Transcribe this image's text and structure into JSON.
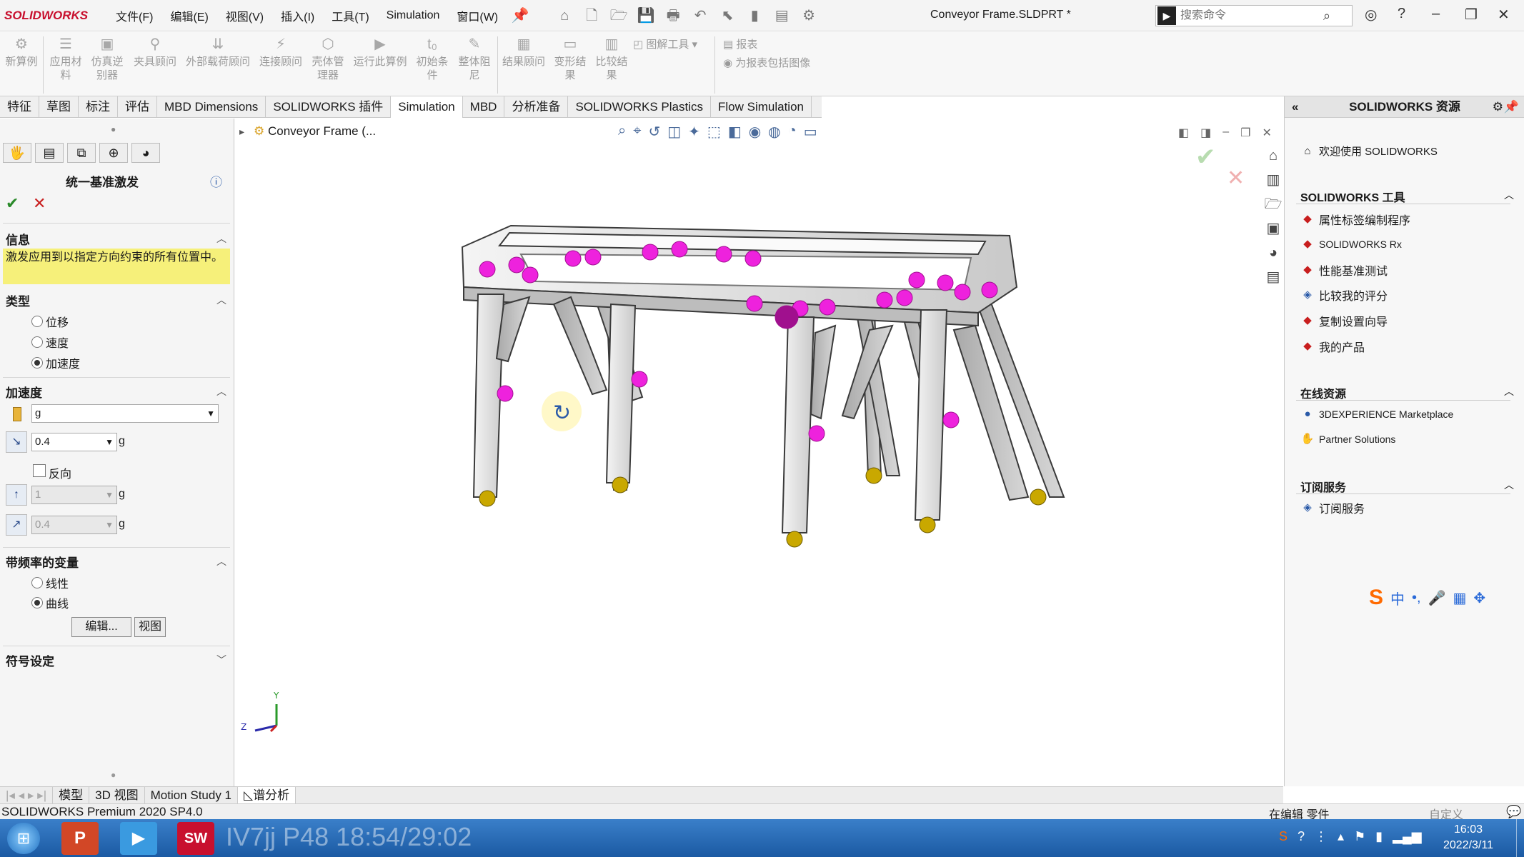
{
  "app": {
    "brand": "SOLIDWORKS",
    "doc_title": "Conveyor Frame.SLDPRT *",
    "menu": [
      "文件(F)",
      "编辑(E)",
      "视图(V)",
      "插入(I)",
      "工具(T)",
      "Simulation",
      "窗口(W)"
    ],
    "search_placeholder": "搜索命令"
  },
  "ribbon": {
    "buttons": [
      "新算例",
      "应用材料",
      "仿真逆别器",
      "夹具顾问",
      "外部载荷顾问",
      "连接顾问",
      "壳体管理器",
      "运行此算例",
      "初始条件",
      "整体阻尼",
      "结果顾问",
      "变形结果",
      "比较结果"
    ],
    "side": [
      "图解工具",
      "报表",
      "为报表包括图像"
    ]
  },
  "tabs": [
    "特征",
    "草图",
    "标注",
    "评估",
    "MBD Dimensions",
    "SOLIDWORKS 插件",
    "Simulation",
    "MBD",
    "分析准备",
    "SOLIDWORKS Plastics",
    "Flow Simulation"
  ],
  "active_tab": "Simulation",
  "left": {
    "title": "统一基准激发",
    "info_head": "信息",
    "info_text": "激发应用到以指定方向约束的所有位置中。",
    "type_head": "类型",
    "types": [
      "位移",
      "速度",
      "加速度"
    ],
    "type_selected": "加速度",
    "accel_head": "加速度",
    "unit": "g",
    "value1": "0.4",
    "reverse": "反向",
    "value2": "1",
    "value3": "0.4",
    "freq_head": "带频率的变量",
    "freq_opts": [
      "线性",
      "曲线"
    ],
    "freq_selected": "曲线",
    "edit_btn": "编辑...",
    "view_btn": "视图",
    "symbol_head": "符号设定"
  },
  "viewport": {
    "tree_root": "Conveyor Frame (..."
  },
  "right": {
    "title": "SOLIDWORKS 资源",
    "welcome": "欢迎使用 SOLIDWORKS",
    "tools_head": "SOLIDWORKS 工具",
    "tools": [
      "属性标签编制程序",
      "SOLIDWORKS Rx",
      "性能基准测试",
      "比较我的评分",
      "复制设置向导",
      "我的产品"
    ],
    "online_head": "在线资源",
    "online": [
      "3DEXPERIENCE Marketplace",
      "Partner Solutions"
    ],
    "sub_head": "订阅服务",
    "sub": [
      "订阅服务"
    ]
  },
  "bottom_tabs": [
    "模型",
    "3D 视图",
    "Motion Study 1",
    "谱分析"
  ],
  "status": {
    "left": "SOLIDWORKS Premium 2020 SP4.0",
    "mid": "在编辑 零件",
    "right": "自定义"
  },
  "taskbar": {
    "time": "16:03",
    "date": "2022/3/11",
    "overlay": "IV7jj P48 18:54/29:02"
  }
}
